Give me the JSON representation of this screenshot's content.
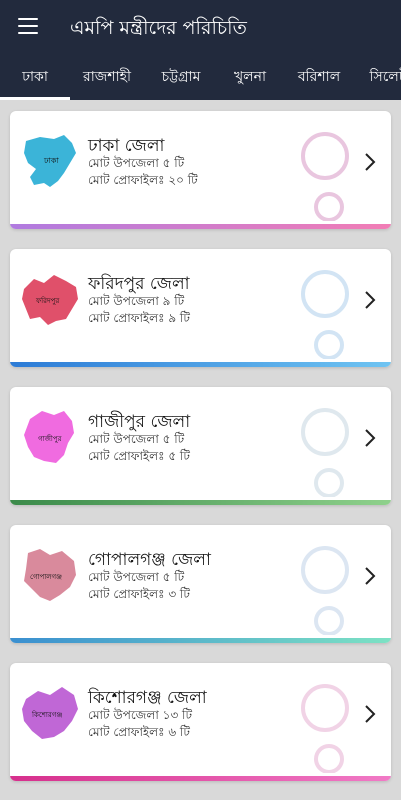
{
  "app": {
    "title": "এমপি মন্ত্রীদের পরিচিতি"
  },
  "tabs": [
    {
      "label": "ঢাকা",
      "active": true
    },
    {
      "label": "রাজশাহী",
      "active": false
    },
    {
      "label": "চট্টগ্রাম",
      "active": false
    },
    {
      "label": "খুলনা",
      "active": false
    },
    {
      "label": "বরিশাল",
      "active": false
    },
    {
      "label": "সিলেট",
      "active": false
    }
  ],
  "districts": [
    {
      "name": "ঢাকা জেলা",
      "upazila": "মোট উপজেলা ৫ টি",
      "profiles": "মোট প্রোফাইলঃ ২০ টি",
      "map_label": "ঢাকা",
      "map_color": "#3bb4d8",
      "bar_color": "#b07be0",
      "bar_color2": "#f27db5",
      "deco_color": "#e9c6df"
    },
    {
      "name": "ফরিদপুর জেলা",
      "upazila": "মোট উপজেলা ৯ টি",
      "profiles": "মোট প্রোফাইলঃ ৯ টি",
      "map_label": "ফরিদপুর",
      "map_color": "#e0506a",
      "bar_color": "#2c7bd6",
      "bar_color2": "#6fc4f2",
      "deco_color": "#d2e4f4"
    },
    {
      "name": "গাজীপুর জেলা",
      "upazila": "মোট উপজেলা ৫ টি",
      "profiles": "মোট প্রোফাইলঃ ৫ টি",
      "map_label": "গাজীপুর",
      "map_color": "#f06be0",
      "bar_color": "#3b8a4a",
      "bar_color2": "#8fd18c",
      "deco_color": "#dfe8ee"
    },
    {
      "name": "গোপালগঞ্জ জেলা",
      "upazila": "মোট উপজেলা ৫ টি",
      "profiles": "মোট প্রোফাইলঃ ৩ টি",
      "map_label": "গোপালগঞ্জ",
      "map_color": "#d98a9c",
      "bar_color": "#3a8fd0",
      "bar_color2": "#7de2c4",
      "deco_color": "#dce6f2"
    },
    {
      "name": "কিশোরগঞ্জ জেলা",
      "upazila": "মোট উপজেলা ১৩ টি",
      "profiles": "মোট প্রোফাইলঃ ৬ টি",
      "map_label": "কিশোরগঞ্জ",
      "map_color": "#c067d6",
      "bar_color": "#d62f8c",
      "bar_color2": "#f17ac6",
      "deco_color": "#f1d3e6"
    }
  ]
}
